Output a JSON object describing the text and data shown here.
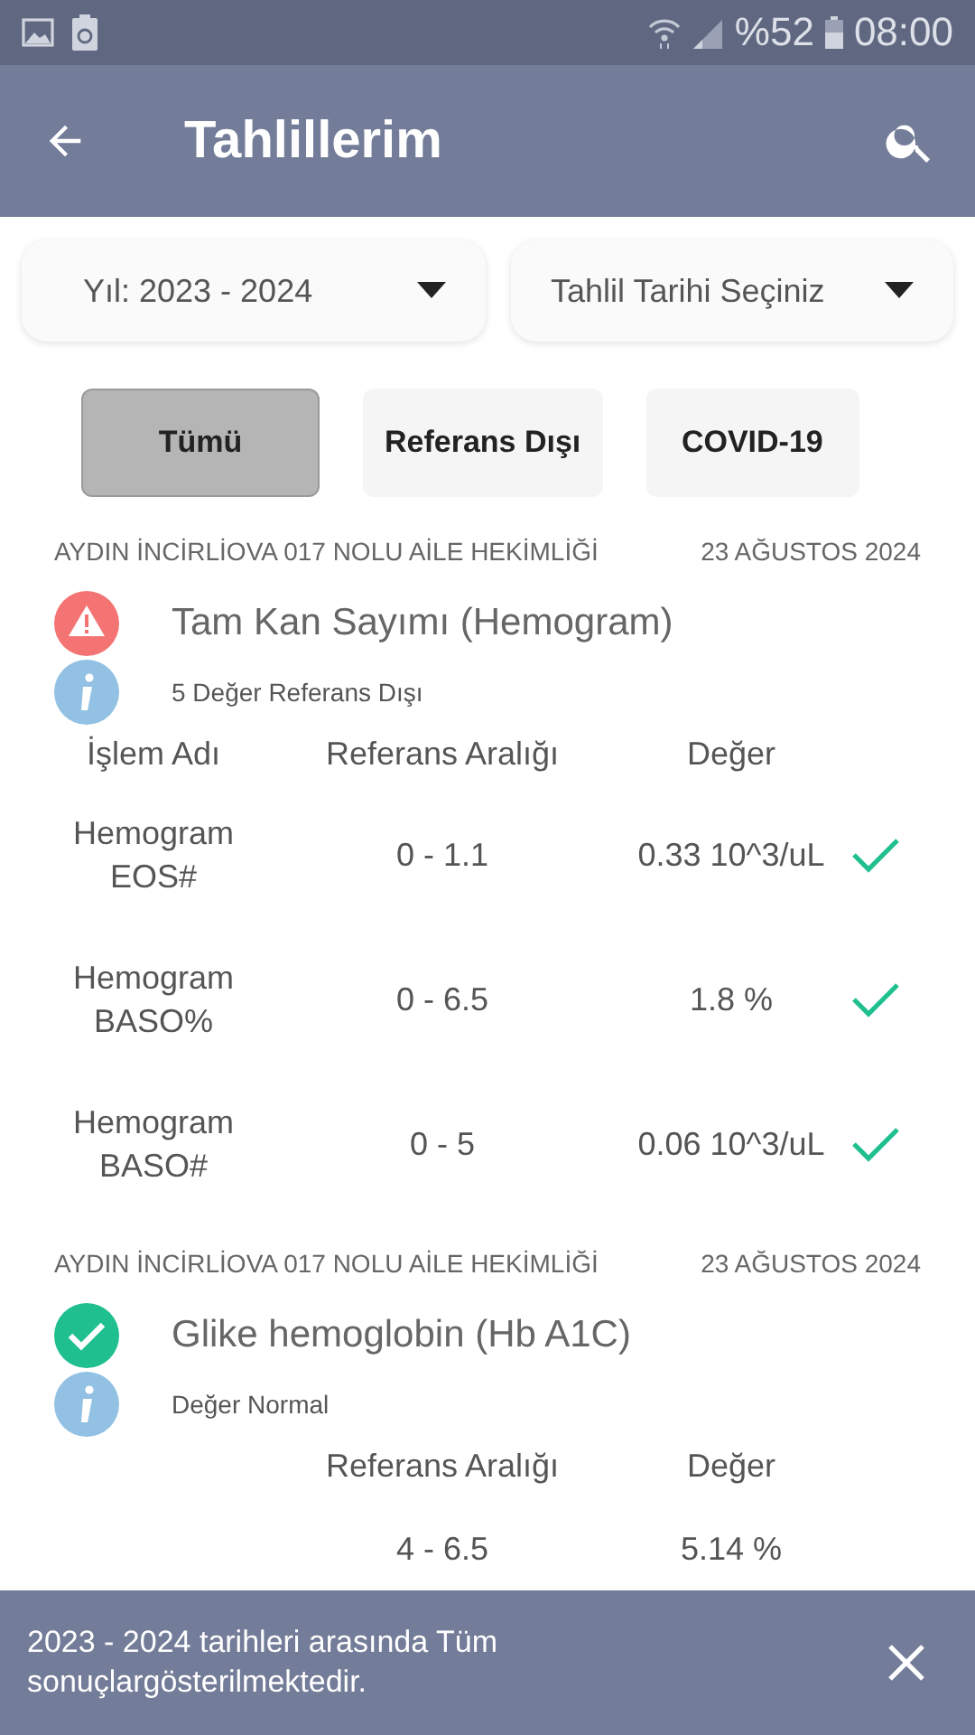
{
  "status_bar": {
    "battery": "%52",
    "time": "08:00"
  },
  "app_bar": {
    "title": "Tahlillerim"
  },
  "dropdowns": [
    {
      "label": "Yıl: 2023 - 2024"
    },
    {
      "label": "Tahlil Tarihi Seçiniz"
    }
  ],
  "filters": [
    {
      "label": "Tümü",
      "selected": true
    },
    {
      "label": "Referans Dışı",
      "selected": false
    },
    {
      "label": "COVID-19",
      "selected": false
    }
  ],
  "results": [
    {
      "facility": "AYDIN İNCİRLİOVA 017 NOLU AİLE HEKİMLİĞİ",
      "date": "23 AĞUSTOS 2024",
      "kind": "warning",
      "title": "Tam Kan Sayımı (Hemogram)",
      "info": "5 Değer Referans Dışı",
      "columns": [
        {
          "kind": "name",
          "label": "İşlem Adı"
        },
        {
          "kind": "range",
          "label": "Referans Aralığı"
        },
        {
          "kind": "value",
          "label": "Değer"
        }
      ],
      "rows": [
        {
          "name": "Hemogram EOS#",
          "range": "0 - 1.1",
          "value": "0.33 10^3/uL",
          "normal": true
        },
        {
          "name": "Hemogram BASO%",
          "range": "0 - 6.5",
          "value": "1.8 %",
          "normal": true
        },
        {
          "name": "Hemogram BASO#",
          "range": "0 - 5",
          "value": "0.06 10^3/uL",
          "normal": true
        }
      ]
    },
    {
      "facility": "AYDIN İNCİRLİOVA 017 NOLU AİLE HEKİMLİĞİ",
      "date": "23 AĞUSTOS 2024",
      "kind": "ok",
      "title": "Glike hemoglobin (Hb A1C)",
      "info": "Değer Normal",
      "columns": [
        {
          "kind": "range",
          "label": "Referans Aralığı"
        },
        {
          "kind": "value",
          "label": "Değer"
        }
      ],
      "rows": [
        {
          "range": "4  -  6.5",
          "value": "5.14 %"
        }
      ]
    }
  ],
  "snackbar": {
    "message": "2023 - 2024 tarihleri arasında Tüm sonuçlargösterilmektedir."
  }
}
